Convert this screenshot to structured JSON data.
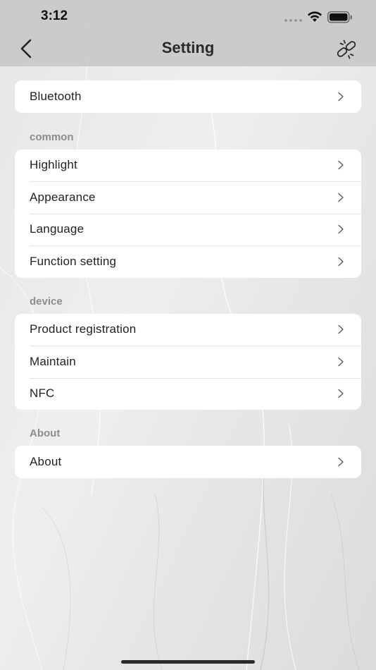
{
  "status_bar": {
    "time": "3:12"
  },
  "nav": {
    "title": "Setting",
    "back_icon": "chevron-left-icon",
    "action_icon": "unlink-icon"
  },
  "groups": [
    {
      "header": "",
      "items": [
        {
          "label": "Bluetooth"
        }
      ]
    },
    {
      "header": "common",
      "items": [
        {
          "label": "Highlight"
        },
        {
          "label": "Appearance"
        },
        {
          "label": "Language"
        },
        {
          "label": "Function setting"
        }
      ]
    },
    {
      "header": "device",
      "items": [
        {
          "label": "Product registration"
        },
        {
          "label": "Maintain"
        },
        {
          "label": "NFC"
        }
      ]
    },
    {
      "header": "About",
      "items": [
        {
          "label": "About"
        }
      ]
    }
  ],
  "colors": {
    "card_bg": "#ffffff",
    "section_header": "#8c8c8c",
    "topbar_bg": "#c8c8c8"
  }
}
